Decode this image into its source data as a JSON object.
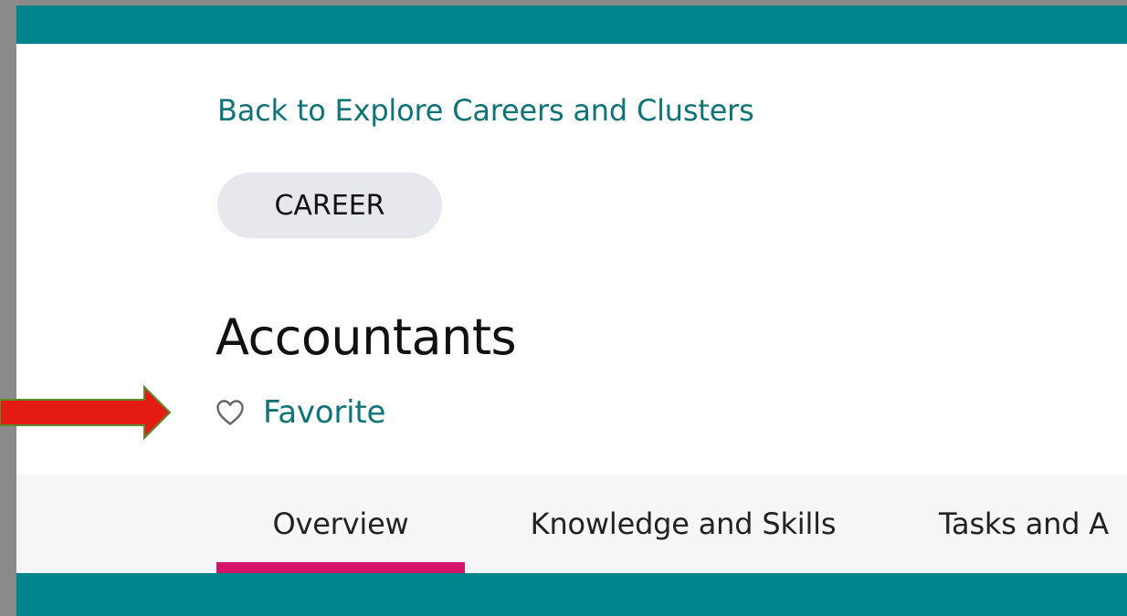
{
  "header": {
    "back_link": "Back to Explore Careers and Clusters"
  },
  "career": {
    "type_label": "CAREER",
    "title": "Accountants",
    "favorite_label": "Favorite"
  },
  "tabs": [
    {
      "label": "Overview",
      "active": true
    },
    {
      "label": "Knowledge and Skills",
      "active": false
    },
    {
      "label": "Tasks and A",
      "active": false
    }
  ],
  "colors": {
    "brand_teal": "#00848c",
    "link_teal": "#0f7378",
    "active_tab_underline": "#d4146a",
    "annotation_arrow": "#e31b12"
  },
  "icons": {
    "favorite": "heart-outline-icon",
    "annotation": "red-arrow"
  }
}
